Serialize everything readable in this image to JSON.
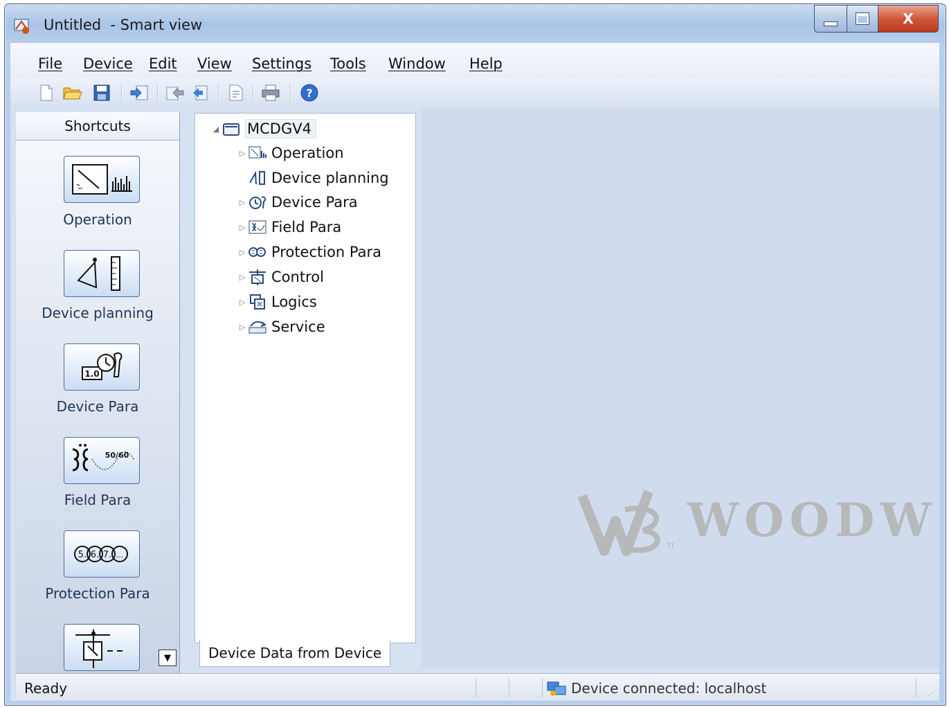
{
  "window": {
    "title": "Untitled  - Smart view",
    "close_glyph": "X"
  },
  "menu": {
    "items": [
      {
        "label": "File"
      },
      {
        "label": "Device"
      },
      {
        "label": "Edit"
      },
      {
        "label": "View"
      },
      {
        "label": "Settings"
      },
      {
        "label": "Tools"
      },
      {
        "label": "Window"
      },
      {
        "label": "Help"
      }
    ]
  },
  "toolbar": {
    "icons": [
      "new-file-icon",
      "open-folder-icon",
      "save-icon",
      "transfer-to-device-icon",
      "receive-from-device-icon",
      "print-preview-icon",
      "export-icon",
      "print-icon",
      "help-icon"
    ]
  },
  "shortcuts": {
    "header": "Shortcuts",
    "items": [
      {
        "label": "Operation",
        "icon": "operation-icon"
      },
      {
        "label": "Device planning",
        "icon": "device-planning-icon"
      },
      {
        "label": "Device Para",
        "icon": "device-para-icon"
      },
      {
        "label": "Field Para",
        "icon": "field-para-icon"
      },
      {
        "label": "Protection Para",
        "icon": "protection-para-icon"
      },
      {
        "label": "",
        "icon": "control-icon"
      }
    ],
    "field_para_glyph": "50/60",
    "device_para_glyph": "1.0",
    "protection_glyphs": [
      "5.",
      "6.",
      "7.",
      "..."
    ]
  },
  "tree": {
    "root": {
      "label": "MCDGV4"
    },
    "children": [
      {
        "label": "Operation",
        "icon": "operation-icon"
      },
      {
        "label": "Device planning",
        "icon": "device-planning-icon"
      },
      {
        "label": "Device Para",
        "icon": "device-para-icon"
      },
      {
        "label": "Field Para",
        "icon": "field-para-icon"
      },
      {
        "label": "Protection Para",
        "icon": "protection-para-icon"
      },
      {
        "label": "Control",
        "icon": "control-icon"
      },
      {
        "label": "Logics",
        "icon": "logics-icon"
      },
      {
        "label": "Service",
        "icon": "service-icon"
      }
    ],
    "tab_label": "Device Data from Device"
  },
  "workspace": {
    "watermark_text": "WOODW",
    "watermark_tm": "TM"
  },
  "status": {
    "left": "Ready",
    "connection": "Device connected: localhost"
  },
  "colors": {
    "accent": "#2f5ea8",
    "workspace_bg": "#d0dcee"
  }
}
